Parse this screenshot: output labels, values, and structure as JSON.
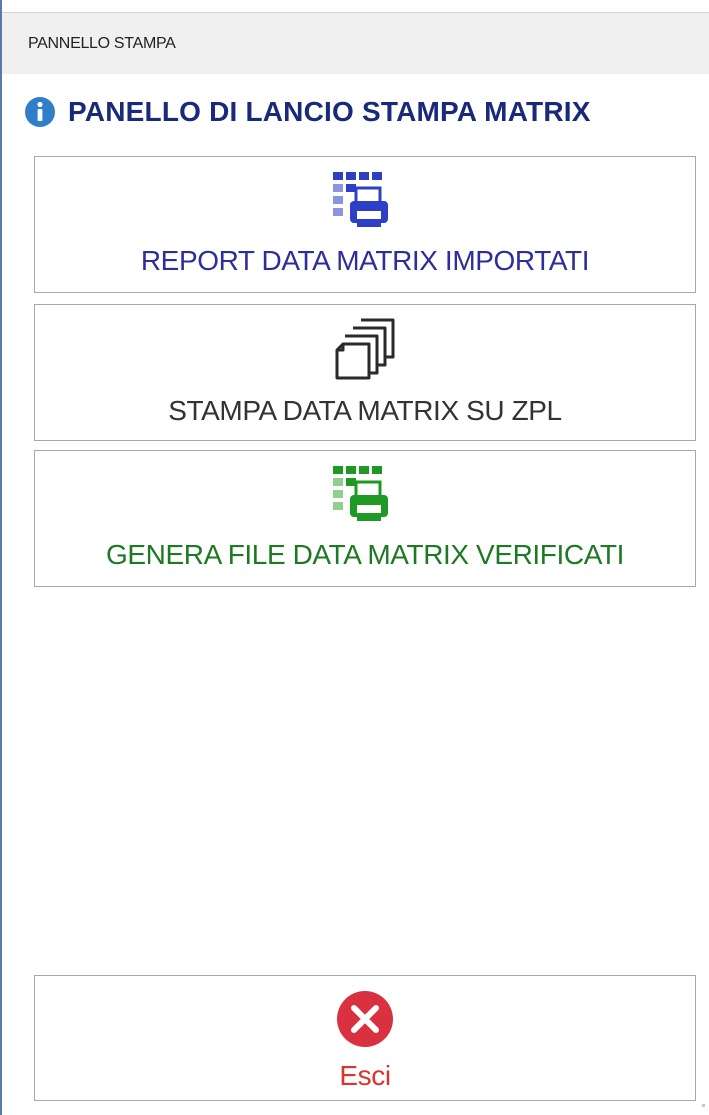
{
  "window": {
    "title": "PANNELLO STAMPA"
  },
  "panel": {
    "heading": "PANELLO DI LANCIO STAMPA MATRIX",
    "heading_icon": "info-icon"
  },
  "buttons": {
    "report": {
      "label": "REPORT DATA MATRIX IMPORTATI",
      "icon": "grid-printer-icon",
      "color": "#2e2e9a"
    },
    "zpl": {
      "label": "STAMPA DATA MATRIX SU ZPL",
      "icon": "stacked-pages-icon",
      "color": "#333333"
    },
    "genera": {
      "label": "GENERA FILE DATA MATRIX VERIFICATI",
      "icon": "grid-printer-icon",
      "color": "#1e7a22"
    },
    "esci": {
      "label": "Esci",
      "icon": "close-circle-icon",
      "color": "#e03030"
    }
  }
}
